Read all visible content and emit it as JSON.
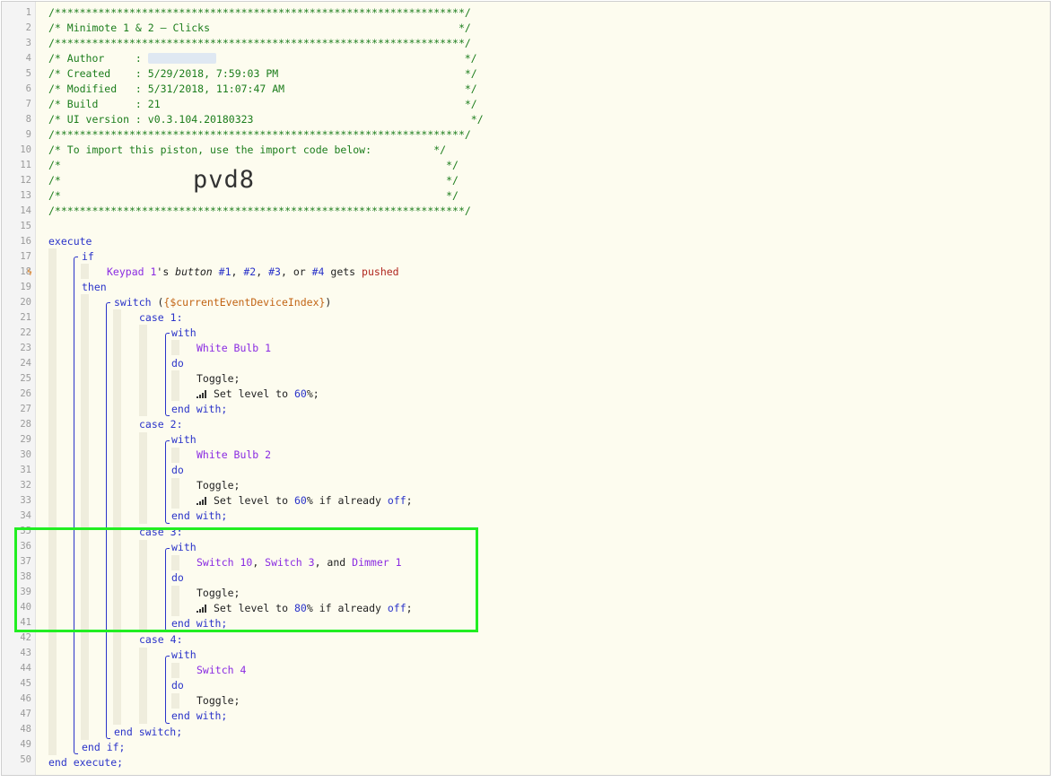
{
  "header": {
    "border": "/******************************************************************/",
    "title_line": "/* Minimote 1 & 2 — Clicks                                        */",
    "author_label": "/* Author     : ",
    "author_end": "                                        */",
    "created_line": "/* Created    : 5/29/2018, 7:59:03 PM                              */",
    "modified_line": "/* Modified   : 5/31/2018, 11:07:47 AM                             */",
    "build_line": "/* Build      : 21                                                 */",
    "ui_line": "/* UI version : v0.3.104.20180323                                   */",
    "import_line": "/* To import this piston, use the import code below:          */",
    "empty_line": "/*                                                              */",
    "import_code": "pvd8"
  },
  "code": {
    "execute": "execute",
    "if": "if",
    "trigger_device": "Keypad 1",
    "trigger_s": "'s ",
    "trigger_attr": "button",
    "trigger_b1": "#1",
    "trigger_b2": "#2",
    "trigger_b3": "#3",
    "trigger_or": "or",
    "trigger_b4": "#4",
    "trigger_gets": "gets",
    "trigger_event": "pushed",
    "then": "then",
    "switch": "switch",
    "switch_var": "{$currentEventDeviceIndex}",
    "case": "case",
    "with": "with",
    "do": "do",
    "toggle": "Toggle;",
    "set_level": "Set level to",
    "if_already": "if already",
    "off": "off",
    "end_with": "end with;",
    "end_switch": "end switch;",
    "end_if": "end if;",
    "end_execute": "end execute;",
    "and": "and",
    "cases": [
      {
        "num": "1",
        "device": "White Bulb 1",
        "level": "60",
        "cond": false
      },
      {
        "num": "2",
        "device": "White Bulb 2",
        "level": "60",
        "cond": true
      },
      {
        "num": "3",
        "device_a": "Switch 10",
        "device_b": "Switch 3",
        "device_c": "Dimmer 1",
        "level": "80",
        "cond": true
      },
      {
        "num": "4",
        "device": "Switch 4"
      }
    ]
  },
  "line_numbers": [
    "1",
    "2",
    "3",
    "4",
    "5",
    "6",
    "7",
    "8",
    "9",
    "10",
    "11",
    "12",
    "13",
    "14",
    "15",
    "16",
    "17",
    "18",
    "19",
    "20",
    "21",
    "22",
    "23",
    "24",
    "25",
    "26",
    "27",
    "28",
    "29",
    "30",
    "31",
    "32",
    "33",
    "34",
    "35",
    "36",
    "37",
    "38",
    "39",
    "40",
    "41",
    "42",
    "43",
    "44",
    "45",
    "46",
    "47",
    "48",
    "49",
    "50"
  ],
  "colors": {
    "comment": "#1c7d1c",
    "keyword": "#2a33c9",
    "device": "#8a2be2",
    "event": "#b0261e",
    "variable": "#c26414",
    "highlight": "#22ee22",
    "trigger_bolt": "#f08a24"
  },
  "icons": {
    "trigger": "lightning-bolt-icon",
    "level": "signal-bars-icon"
  }
}
